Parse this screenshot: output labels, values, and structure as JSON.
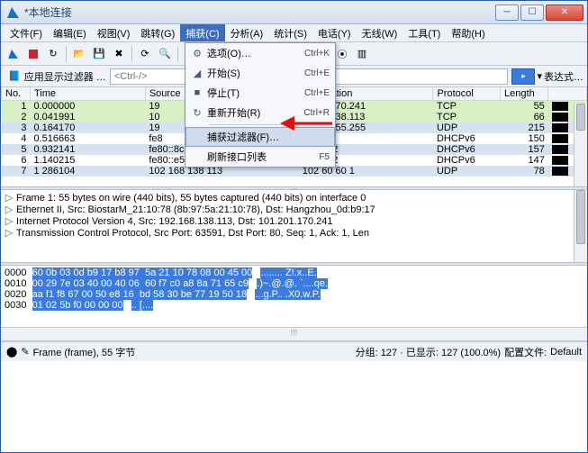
{
  "window": {
    "title": "*本地连接"
  },
  "menu": {
    "items": [
      "文件(F)",
      "编辑(E)",
      "视图(V)",
      "跳转(G)",
      "捕获(C)",
      "分析(A)",
      "统计(S)",
      "电话(Y)",
      "无线(W)",
      "工具(T)",
      "帮助(H)"
    ],
    "active_index": 4
  },
  "capture_menu": {
    "items": [
      {
        "icon": "gear",
        "label": "选项(O)…",
        "shortcut": "Ctrl+K"
      },
      {
        "icon": "sharkfin",
        "label": "开始(S)",
        "shortcut": "Ctrl+E"
      },
      {
        "icon": "stop",
        "label": "停止(T)",
        "shortcut": "Ctrl+E"
      },
      {
        "icon": "restart",
        "label": "重新开始(R)",
        "shortcut": "Ctrl+R"
      },
      {
        "sep": true
      },
      {
        "icon": "",
        "label": "捕获过滤器(F)…",
        "shortcut": "",
        "highlight": true
      },
      {
        "icon": "",
        "label": "刷新接口列表",
        "shortcut": "F5"
      }
    ]
  },
  "filter": {
    "placeholder": "<Ctrl-/>",
    "label": "应用显示过滤器 …",
    "mode": "表达式…"
  },
  "columns": [
    "No.",
    "Time",
    "Source",
    "Destination",
    "Protocol",
    "Length",
    ""
  ],
  "packets": [
    {
      "no": "1",
      "time": "0.000000",
      "src": "19",
      "dst": "1.201.170.241",
      "proto": "TCP",
      "len": "55",
      "cls": "row-green"
    },
    {
      "no": "2",
      "time": "0.041991",
      "src": "10",
      "dst": "2.168.138.113",
      "proto": "TCP",
      "len": "66",
      "cls": "row-green"
    },
    {
      "no": "3",
      "time": "0.164170",
      "src": "19",
      "dst": "5.255.255.255",
      "proto": "UDP",
      "len": "215",
      "cls": "row-blue"
    },
    {
      "no": "4",
      "time": "0.516663",
      "src": "fe8",
      "dst": "02::1:2",
      "proto": "DHCPv6",
      "len": "150",
      "cls": "row-white"
    },
    {
      "no": "5",
      "time": "0.932141",
      "src": "fe80::8c8b:1682:536",
      "dst": "ff02::1:2",
      "proto": "DHCPv6",
      "len": "157",
      "cls": "row-blue"
    },
    {
      "no": "6",
      "time": "1.140215",
      "src": "fe80::e5:7958:b902:…",
      "dst": "ff02::1:2",
      "proto": "DHCPv6",
      "len": "147",
      "cls": "row-white"
    },
    {
      "no": "7",
      "time": "1 286104",
      "src": "102 168 138 113",
      "dst": "102 60 60 1",
      "proto": "UDP",
      "len": "78",
      "cls": "row-blue"
    }
  ],
  "details": [
    "Frame 1: 55 bytes on wire (440 bits), 55 bytes captured (440 bits) on interface 0",
    "Ethernet II, Src: BiostarM_21:10:78 (8b:97:5a:21:10:78), Dst: Hangzhou_0d:b9:17 ",
    "Internet Protocol Version 4, Src: 192.168.138.113, Dst: 101.201.170.241",
    "Transmission Control Protocol, Src Port: 63591, Dst Port: 80, Seq: 1, Ack: 1, Len"
  ],
  "hex": {
    "rows": [
      {
        "off": "0000",
        "hex": "60 0b 03 0d b9 17 b8 97  5a 21 10 78 08 00 45 00",
        "asc": "........ Z!.x..E."
      },
      {
        "off": "0010",
        "hex": "00 29 7e 03 40 00 40 06  60 f7 c0 a8 8a 71 65 c9",
        "asc": ".)~.@.@. `....qe."
      },
      {
        "off": "0020",
        "hex": "aa f1 f8 67 00 50 e8 16  bd 58 30 be 77 19 50 18",
        "asc": "...g.P.. .X0.w.P."
      },
      {
        "off": "0030",
        "hex": "01 02 5b f0 00 00 00",
        "asc": ".. [...."
      }
    ]
  },
  "status": {
    "left": "Frame (frame), 55 字节",
    "right_pkts": "分组: 127 · 已显示: 127 (100.0%)",
    "right_profile_label": "配置文件:",
    "right_profile_value": "Default"
  },
  "colors": {
    "accent": "#3b7be0"
  }
}
